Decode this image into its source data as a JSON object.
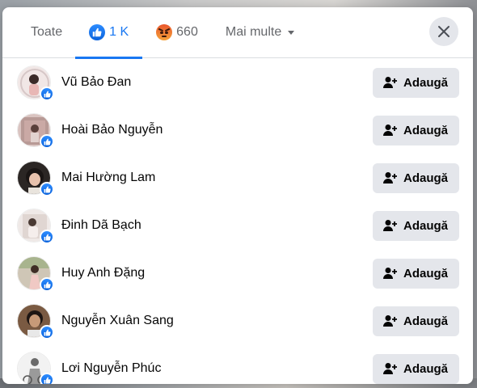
{
  "tabs": [
    {
      "label": "Toate"
    },
    {
      "label": "1 K",
      "icon": "like-icon"
    },
    {
      "label": "660",
      "icon": "angry-icon"
    },
    {
      "label": "Mai multe",
      "icon": "caret-down-icon"
    }
  ],
  "active_tab": 1,
  "colors": {
    "accent": "#1877f2",
    "button_bg": "#e4e6eb",
    "text_primary": "#050505",
    "text_secondary": "#65676b"
  },
  "close_icon": "close-icon",
  "add_button_label": "Adaugă",
  "people": [
    {
      "name": "Vũ Bảo Đan"
    },
    {
      "name": "Hoài Bảo Nguyễn"
    },
    {
      "name": "Mai Hường Lam"
    },
    {
      "name": "Đinh Dã Bạch"
    },
    {
      "name": "Huy Anh Đặng"
    },
    {
      "name": "Nguyễn Xuân Sang"
    },
    {
      "name": "Lơi Nguyễn Phúc"
    }
  ]
}
